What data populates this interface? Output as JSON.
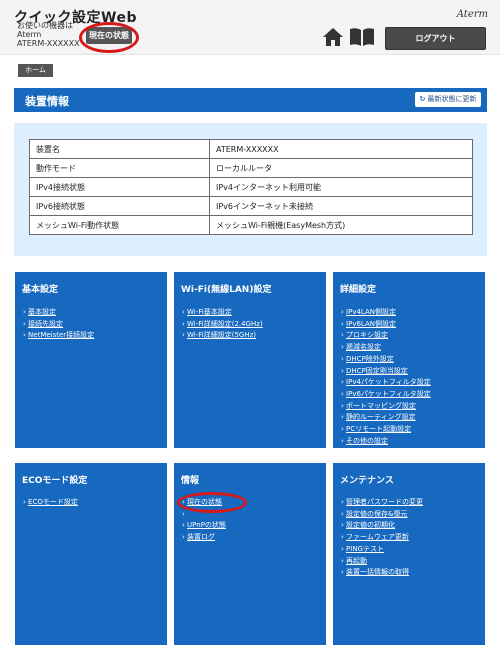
{
  "header": {
    "title": "クイック設定Web",
    "device_lines": [
      "お使いの機器は",
      "Aterm",
      "ATERM-XXXXXX"
    ],
    "status_button": "現在の状態",
    "brand": "Aterm",
    "logout_button": "ログアウト"
  },
  "breadcrumb": {
    "home": "ホーム"
  },
  "device_info": {
    "title": "装置情報",
    "refresh_button": "最新状態に更新",
    "rows": [
      {
        "label": "装置名",
        "value": "ATERM-XXXXXX"
      },
      {
        "label": "動作モード",
        "value": "ローカルルータ"
      },
      {
        "label": "IPv4接続状態",
        "value": "IPv4インターネット利用可能"
      },
      {
        "label": "IPv6接続状態",
        "value": "IPv6インターネット未接続"
      },
      {
        "label": "メッシュWi-Fi動作状態",
        "value": "メッシュWi-Fi親機(EasyMesh方式)"
      }
    ]
  },
  "menu": {
    "basic": {
      "title": "基本設定",
      "items": [
        "基本設定",
        "接続先設定",
        "NetMeister接続設定"
      ]
    },
    "wifi": {
      "title": "Wi-Fi(無線LAN)設定",
      "items": [
        "Wi-Fi基本設定",
        "Wi-Fi詳細設定(2.4GHz)",
        "Wi-Fi詳細設定(5GHz)"
      ]
    },
    "advanced": {
      "title": "詳細設定",
      "items": [
        "IPv4LAN側設定",
        "IPv6LAN側設定",
        "プロキシ設定",
        "逓減名設定",
        "DHCP除外設定",
        "DHCP固定割当設定",
        "IPv4パケットフィルタ設定",
        "IPv6パケットフィルタ設定",
        "ポートマッピング設定",
        "静的ルーティング設定",
        "PCリモート起動設定",
        "その他の設定"
      ]
    },
    "eco": {
      "title": "ECOモード設定",
      "items": [
        "ECOモード設定"
      ]
    },
    "info": {
      "title": "情報",
      "items": [
        "現在の状態",
        "",
        "UPnPの状態",
        "装置ログ"
      ]
    },
    "maintenance": {
      "title": "メンテナンス",
      "items": [
        "管理者パスワードの変更",
        "設定値の保存&復元",
        "設定値の初期化",
        "ファームウェア更新",
        "PINGテスト",
        "再起動",
        "装置一括情報の取得"
      ]
    }
  }
}
